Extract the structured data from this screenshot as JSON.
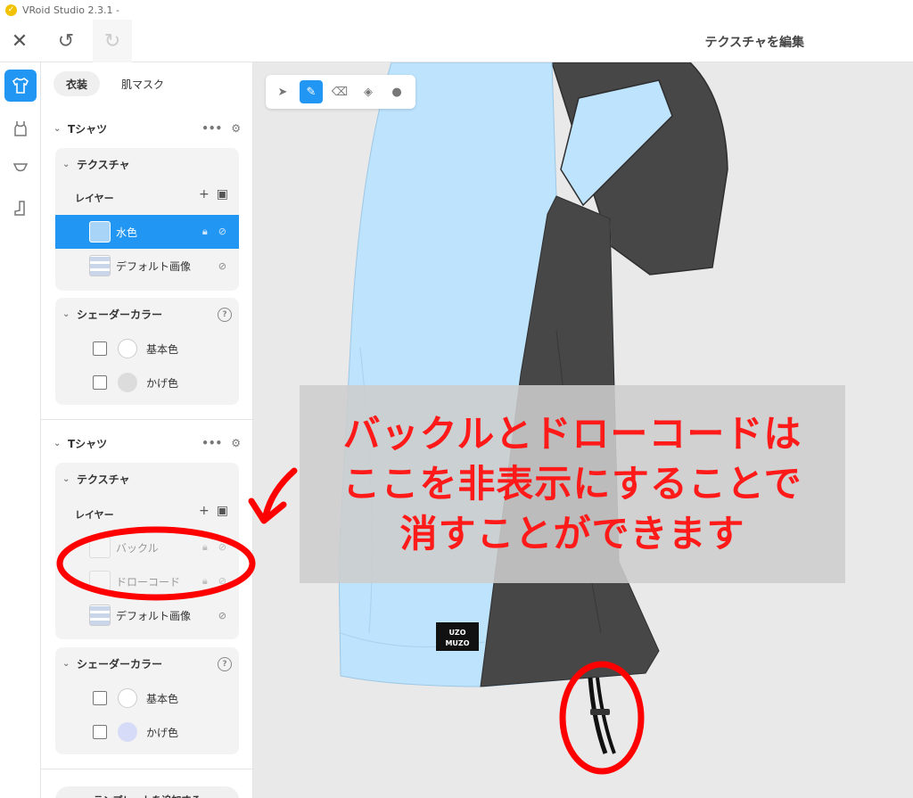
{
  "window": {
    "title": "VRoid Studio 2.3.1 -"
  },
  "toolbar": {
    "page_title": "テクスチャを編集"
  },
  "panel": {
    "tabs": [
      {
        "label": "衣装"
      },
      {
        "label": "肌マスク"
      }
    ],
    "sections": [
      {
        "title": "Tシャツ",
        "texture_title": "テクスチャ",
        "layer_label": "レイヤー",
        "layers": [
          {
            "name": "水色",
            "selected": true
          },
          {
            "name": "デフォルト画像",
            "selected": false
          }
        ],
        "shader_title": "シェーダーカラー",
        "shader_colors": [
          {
            "label": "基本色",
            "color": "#ffffff"
          },
          {
            "label": "かげ色",
            "color": "#dcdcdc"
          }
        ]
      },
      {
        "title": "Tシャツ",
        "texture_title": "テクスチャ",
        "layer_label": "レイヤー",
        "layers": [
          {
            "name": "バックル",
            "hidden": true
          },
          {
            "name": "ドローコード",
            "hidden": true
          },
          {
            "name": "デフォルト画像",
            "hidden": false
          }
        ],
        "shader_title": "シェーダーカラー",
        "shader_colors": [
          {
            "label": "基本色",
            "color": "#ffffff"
          },
          {
            "label": "かげ色",
            "color": "#d6dcf7"
          }
        ]
      }
    ],
    "add_template_label": "テンプレートを追加する"
  },
  "viewport": {
    "logo_text": [
      "UZO",
      "MUZO"
    ],
    "callout_lines": [
      "バックルとドローコードは",
      "ここを非表示にすることで",
      "消すことができます"
    ]
  },
  "colors": {
    "accent": "#2196f3",
    "annotation": "#ff0000",
    "shirt": "#b9e0fb",
    "dark": "#4a4a4a"
  }
}
